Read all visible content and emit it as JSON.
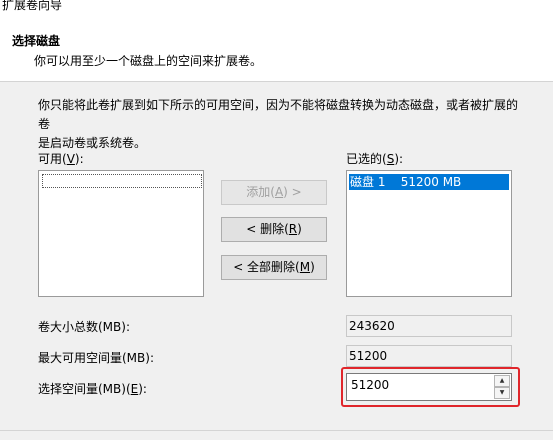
{
  "window": {
    "title": "扩展卷向导"
  },
  "header": {
    "title": "选择磁盘",
    "subtitle": "你可以用至少一个磁盘上的空间来扩展卷。"
  },
  "description": {
    "line1": "你只能将此卷扩展到如下所示的可用空间，因为不能将磁盘转换为动态磁盘，或者被扩展的卷",
    "line2": "是启动卷或系统卷。"
  },
  "available": {
    "label_pre": "可用(",
    "label_key": "V",
    "label_post": "):",
    "items": []
  },
  "selected": {
    "label_pre": "已选的(",
    "label_key": "S",
    "label_post": "):",
    "items": [
      {
        "text": "磁盘 1    51200 MB"
      }
    ]
  },
  "buttons": {
    "add": {
      "pre": "添加(",
      "key": "A",
      "post": ") >"
    },
    "remove": {
      "pre": "< 删除(",
      "key": "R",
      "post": ")"
    },
    "remove_all": {
      "pre": "< 全部删除(",
      "key": "M",
      "post": ")"
    }
  },
  "fields": {
    "total_size": {
      "label": "卷大小总数(MB):",
      "value": "243620"
    },
    "max_available": {
      "label": "最大可用空间量(MB):",
      "value": "51200"
    },
    "select_amount": {
      "label_pre": "选择空间量(MB)(",
      "label_key": "E",
      "label_post": "):",
      "value": "51200"
    }
  },
  "icons": {
    "spin_up": "▲",
    "spin_down": "▼"
  },
  "colors": {
    "selection": "#0078d7",
    "highlight_box": "#e0262b"
  }
}
